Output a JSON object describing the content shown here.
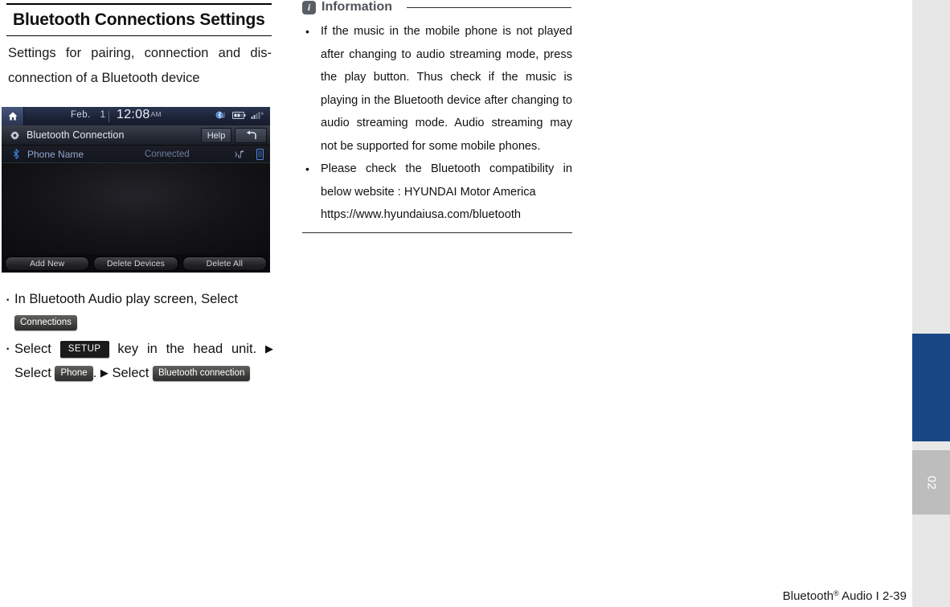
{
  "page": {
    "title": "Bluetooth Connections Settings",
    "intro": "Settings for pairing, connection and dis-connection of a Bluetooth device",
    "footer_text": "Bluetooth",
    "footer_sup": "®",
    "footer_tail": " Audio I 2-39",
    "chapter_number": "02"
  },
  "device_screen": {
    "status_bar": {
      "home_icon": "home-icon",
      "month": "Feb.",
      "day": "1",
      "time": "12:08",
      "ampm": "AM",
      "icons": [
        "bluetooth-audio-icon",
        "battery-icon",
        "signal-icon"
      ]
    },
    "title_bar": {
      "gear_icon": "gear-icon",
      "title": "Bluetooth Connection",
      "help_label": "Help",
      "back_icon": "back-arrow-icon"
    },
    "device_row": {
      "bluetooth_icon": "bluetooth-icon",
      "name": "Phone Name",
      "status": "Connected",
      "icons": [
        "audio-streaming-icon",
        "phone-icon"
      ]
    },
    "buttons": [
      "Add New",
      "Delete Devices",
      "Delete All"
    ]
  },
  "instructions": [
    {
      "prefix": "In Bluetooth Audio play screen, Select",
      "chip": "Connections"
    },
    {
      "seg1": "Select",
      "chip1": "SETUP",
      "seg2": "key in the head unit.",
      "arrow": "▶",
      "seg3": "Select",
      "chip2": "Phone",
      "seg4": ".",
      "arrow2": "▶",
      "seg5": "Select",
      "chip3": "Bluetooth connection"
    }
  ],
  "information": {
    "badge": "i",
    "label": "Information",
    "items": [
      "If the music in the mobile phone is not played after changing to audio streaming mode, press the play button. Thus check if the music is playing in the Bluetooth device after changing to audio streaming mode. Audio streaming may not be supported for some mobile phones.",
      "Please check the Bluetooth compatibility in below website : HYUNDAI Motor America"
    ],
    "url": "https://www.hyundaiusa.com/bluetooth"
  },
  "colors": {
    "tab_blue": "#184785",
    "tab_gray": "#bdbdbd",
    "edge_bg": "#e7e7e7"
  }
}
